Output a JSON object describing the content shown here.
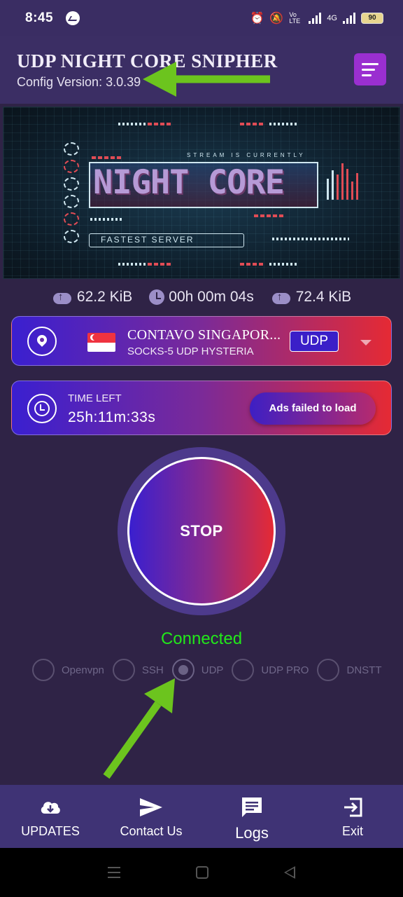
{
  "status_bar": {
    "time": "8:45",
    "network_label": "4G",
    "volte_label": "Vo LTE",
    "battery": "90"
  },
  "header": {
    "title": "UDP NIGHT CORE SNIPHER",
    "config_version": "Config Version: 3.0.39"
  },
  "banner": {
    "logo_text": "NIGHT CORE",
    "tagline": "STREAM IS CURRENTLY",
    "subtitle": "FASTEST SERVER"
  },
  "stats": {
    "upload": "62.2 KiB",
    "duration": "00h 00m 04s",
    "download": "72.4 KiB"
  },
  "server": {
    "name": "CONTAVO SINGAPOR...",
    "type": "SOCKS-5 UDP HYSTERIA",
    "protocol": "UDP"
  },
  "timer": {
    "label": "TIME LEFT",
    "value": "25h:11m:33s",
    "ads_button": "Ads failed to load"
  },
  "main": {
    "stop_label": "STOP",
    "status": "Connected",
    "status_color": "#22e81a"
  },
  "protocols": [
    {
      "label": "Openvpn",
      "selected": false
    },
    {
      "label": "SSH",
      "selected": false
    },
    {
      "label": "UDP",
      "selected": true
    },
    {
      "label": "UDP PRO",
      "selected": false
    },
    {
      "label": "DNSTT",
      "selected": false
    }
  ],
  "bottom_nav": {
    "updates": "UPDATES",
    "contact": "Contact Us",
    "logs": "Logs",
    "exit": "Exit"
  },
  "colors": {
    "background": "#2f2346",
    "header": "#3b2e64",
    "accent": "#9a2fd0",
    "gradient_start": "#3a1fd0",
    "gradient_end": "#e52a34",
    "annotation_arrow": "#6cc41e"
  }
}
